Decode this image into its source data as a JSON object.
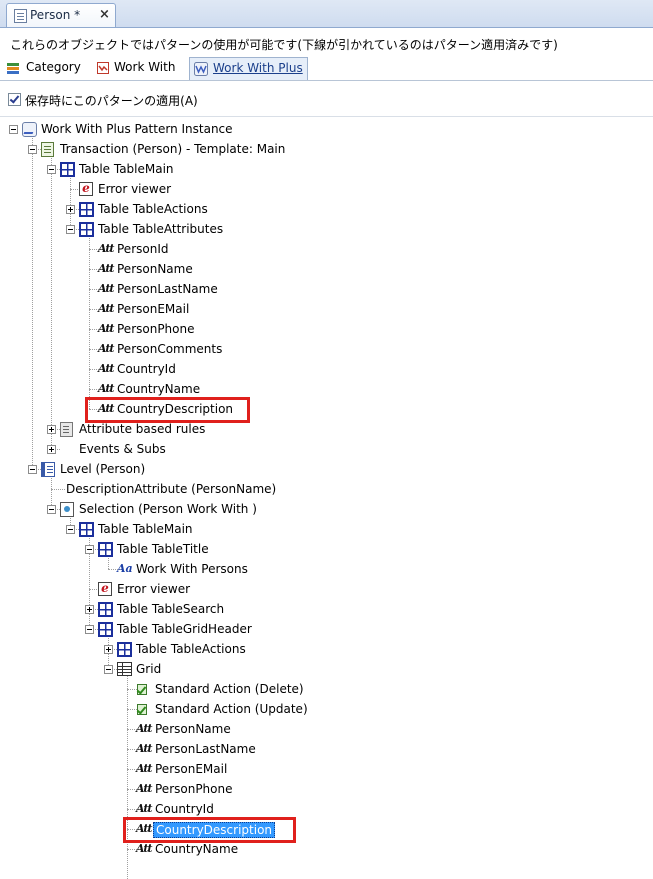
{
  "doc_tab": {
    "title": "Person *",
    "close": "×"
  },
  "description": "これらのオブジェクトではパターンの使用が可能です(下線が引かれているのはパターン適用済みです)",
  "pattern_tabs": [
    {
      "label": "Category",
      "icon": "category-icon",
      "active": false
    },
    {
      "label": "Work With",
      "icon": "work-with-icon",
      "active": false
    },
    {
      "label": "Work With Plus",
      "icon": "work-with-plus-icon",
      "active": true
    }
  ],
  "apply_on_save": {
    "label": "保存時にこのパターンの適用(A)",
    "checked": true
  },
  "tree": [
    {
      "label": "Work With Plus Pattern Instance",
      "icon": "wwp"
    },
    {
      "label": "Transaction (Person) - Template: Main",
      "icon": "trn"
    },
    {
      "label": "Table TableMain",
      "icon": "table"
    },
    {
      "label": "Error viewer",
      "icon": "err"
    },
    {
      "label": "Table TableActions",
      "icon": "table"
    },
    {
      "label": "Table TableAttributes",
      "icon": "table"
    },
    {
      "label": "PersonId",
      "icon": "att"
    },
    {
      "label": "PersonName",
      "icon": "att"
    },
    {
      "label": "PersonLastName",
      "icon": "att"
    },
    {
      "label": "PersonEMail",
      "icon": "att"
    },
    {
      "label": "PersonPhone",
      "icon": "att"
    },
    {
      "label": "PersonComments",
      "icon": "att"
    },
    {
      "label": "CountryId",
      "icon": "att"
    },
    {
      "label": "CountryName",
      "icon": "att"
    },
    {
      "label": "CountryDescription",
      "icon": "att",
      "highlighted": true
    },
    {
      "label": "Attribute based rules",
      "icon": "rules"
    },
    {
      "label": "Events & Subs",
      "icon": "events"
    },
    {
      "label": "Level (Person)",
      "icon": "level"
    },
    {
      "label": "DescriptionAttribute (PersonName)",
      "icon": "none"
    },
    {
      "label": "Selection (Person Work With )",
      "icon": "sel"
    },
    {
      "label": "Table TableMain",
      "icon": "table"
    },
    {
      "label": "Table TableTitle",
      "icon": "table"
    },
    {
      "label": "Work With Persons",
      "icon": "text"
    },
    {
      "label": "Error viewer",
      "icon": "err"
    },
    {
      "label": "Table TableSearch",
      "icon": "table"
    },
    {
      "label": "Table TableGridHeader",
      "icon": "table"
    },
    {
      "label": "Table TableActions",
      "icon": "table"
    },
    {
      "label": "Grid",
      "icon": "grid"
    },
    {
      "label": "Standard Action (Delete)",
      "icon": "std"
    },
    {
      "label": "Standard Action (Update)",
      "icon": "std"
    },
    {
      "label": "PersonName",
      "icon": "att"
    },
    {
      "label": "PersonLastName",
      "icon": "att"
    },
    {
      "label": "PersonEMail",
      "icon": "att"
    },
    {
      "label": "PersonPhone",
      "icon": "att"
    },
    {
      "label": "CountryId",
      "icon": "att"
    },
    {
      "label": "CountryDescription",
      "icon": "att",
      "highlighted": true,
      "selected": true
    },
    {
      "label": "CountryName",
      "icon": "att"
    }
  ],
  "colors": {
    "highlight_box": "#e0201c",
    "selection": "#3399ff",
    "table_icon": "#1b2f9c"
  }
}
